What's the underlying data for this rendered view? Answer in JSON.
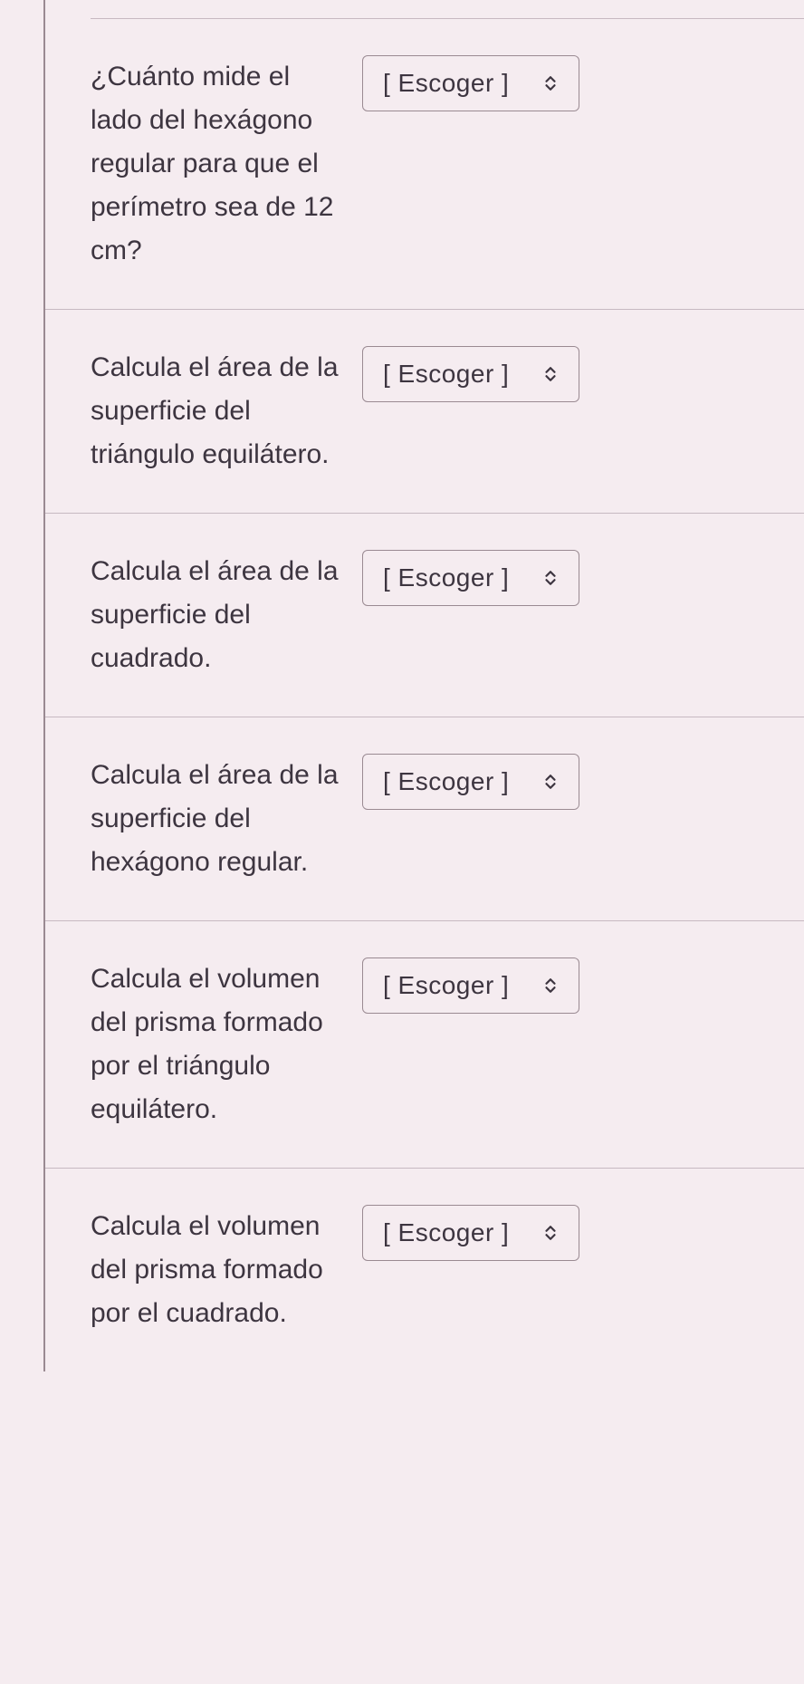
{
  "questions": [
    {
      "text": "¿Cuánto mide el lado del hexágono regular para que el perímetro sea de 12 cm?",
      "select_label": "[ Escoger ]"
    },
    {
      "text": "Calcula el área de la superficie del triángulo equilátero.",
      "select_label": "[ Escoger ]"
    },
    {
      "text": "Calcula el área de la superficie del cuadrado.",
      "select_label": "[ Escoger ]"
    },
    {
      "text": "Calcula el área de la superficie del hexágono regular.",
      "select_label": "[ Escoger ]"
    },
    {
      "text": "Calcula el volumen del prisma formado por el triángulo equilátero.",
      "select_label": "[ Escoger ]"
    },
    {
      "text": "Calcula el volumen del prisma formado por el cuadrado.",
      "select_label": "[ Escoger ]"
    }
  ]
}
